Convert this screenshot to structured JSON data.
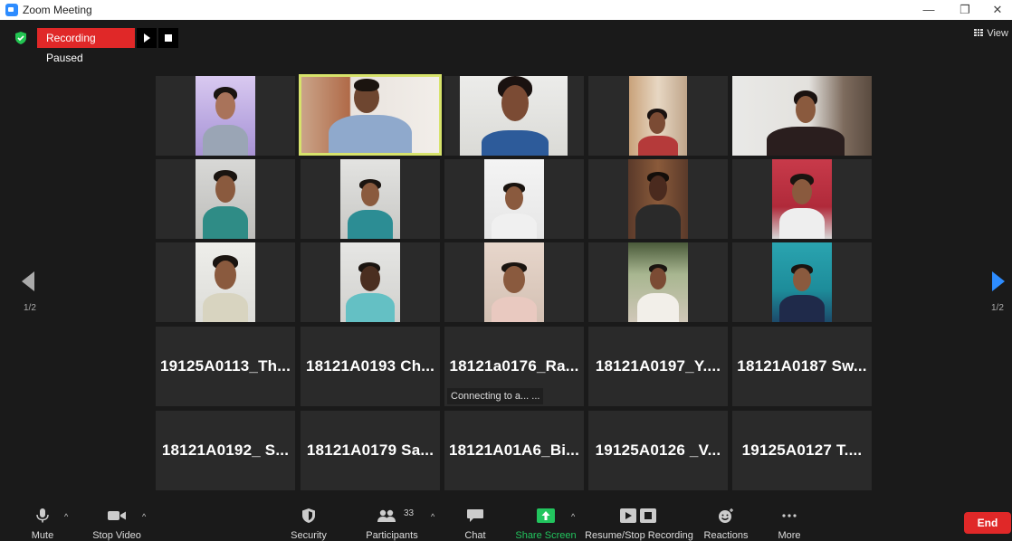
{
  "window": {
    "title": "Zoom Meeting"
  },
  "recording": {
    "status_label": "Recording Paused"
  },
  "view": {
    "label": "View"
  },
  "pagination": {
    "left": "1/2",
    "right": "1/2"
  },
  "video_tiles": [
    {
      "name": "participant-video-1"
    },
    {
      "name": "participant-video-2-active-speaker"
    },
    {
      "name": "participant-video-3"
    },
    {
      "name": "participant-video-4"
    },
    {
      "name": "participant-video-5"
    },
    {
      "name": "participant-video-6"
    },
    {
      "name": "participant-video-7"
    },
    {
      "name": "participant-video-8"
    },
    {
      "name": "participant-video-9"
    },
    {
      "name": "participant-video-10"
    },
    {
      "name": "participant-video-11"
    },
    {
      "name": "participant-video-12"
    },
    {
      "name": "participant-video-13"
    },
    {
      "name": "participant-video-14"
    },
    {
      "name": "participant-video-15"
    }
  ],
  "name_tiles": [
    {
      "name": "19125A0113_Th...",
      "status": ""
    },
    {
      "name": "18121A0193 Ch...",
      "status": ""
    },
    {
      "name": "18121a0176_Ra...",
      "status": "Connecting to a... ..."
    },
    {
      "name": "18121A0197_Y....",
      "status": ""
    },
    {
      "name": "18121A0187 Sw...",
      "status": ""
    },
    {
      "name": "18121A0192_ S...",
      "status": ""
    },
    {
      "name": "18121A0179 Sa...",
      "status": ""
    },
    {
      "name": "18121A01A6_Bi...",
      "status": ""
    },
    {
      "name": "19125A0126 _V...",
      "status": ""
    },
    {
      "name": "19125A0127 T....",
      "status": ""
    }
  ],
  "toolbar": {
    "mute": "Mute",
    "stop_video": "Stop Video",
    "security": "Security",
    "participants": "Participants",
    "participants_count": "33",
    "chat": "Chat",
    "share_screen": "Share Screen",
    "resume_stop_recording": "Resume/Stop Recording",
    "reactions": "Reactions",
    "more": "More",
    "end": "End"
  },
  "colors": {
    "share_green": "#22c55e",
    "end_red": "#e02828",
    "speaker_highlight": "#d7e36b",
    "next_arrow_blue": "#2d8cff"
  }
}
